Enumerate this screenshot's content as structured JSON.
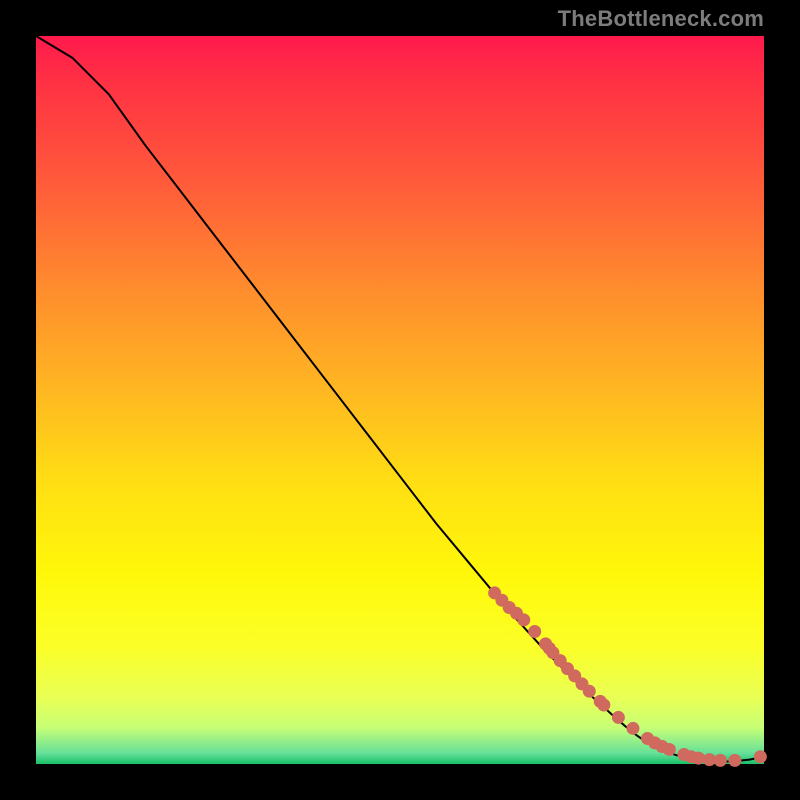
{
  "watermark": "TheBottleneck.com",
  "colors": {
    "curve": "#000000",
    "marker_fill": "#d06a5e",
    "marker_stroke": "#b54d41"
  },
  "chart_data": {
    "type": "line",
    "title": "",
    "xlabel": "",
    "ylabel": "",
    "xlim": [
      0,
      100
    ],
    "ylim": [
      0,
      100
    ],
    "grid": false,
    "series": [
      {
        "name": "bottleneck-curve",
        "x": [
          0,
          5,
          10,
          15,
          20,
          25,
          30,
          35,
          40,
          45,
          50,
          55,
          60,
          65,
          70,
          75,
          80,
          82,
          84,
          86,
          88,
          90,
          92,
          94,
          96,
          98,
          100
        ],
        "y": [
          100,
          97,
          92,
          85,
          78.5,
          72,
          65.5,
          59,
          52.5,
          46,
          39.5,
          33,
          27,
          21,
          15.5,
          10.5,
          6,
          4.3,
          2.9,
          1.9,
          1.2,
          0.7,
          0.4,
          0.3,
          0.4,
          0.6,
          1.0
        ]
      }
    ],
    "highlight_markers": {
      "name": "highlighted-points",
      "x": [
        63,
        64,
        65,
        66,
        67,
        68.5,
        70,
        70.5,
        71,
        72,
        73,
        74,
        75,
        76,
        77.5,
        78,
        80,
        82,
        84,
        85,
        86,
        87,
        89,
        90,
        91,
        92.5,
        94,
        96,
        99.5
      ],
      "y": [
        23.5,
        22.5,
        21.5,
        20.7,
        19.8,
        18.2,
        16.5,
        15.9,
        15.3,
        14.2,
        13.1,
        12.1,
        11.0,
        10.0,
        8.6,
        8.1,
        6.4,
        4.9,
        3.5,
        2.9,
        2.4,
        2.0,
        1.3,
        1.0,
        0.8,
        0.6,
        0.5,
        0.5,
        1.0
      ]
    }
  }
}
